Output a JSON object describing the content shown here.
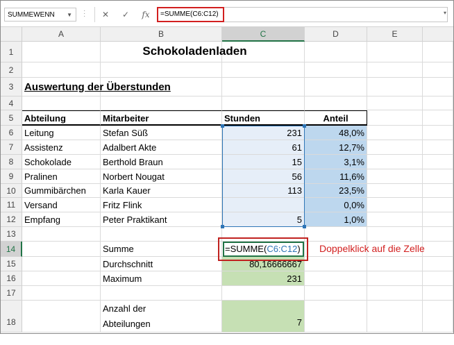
{
  "formula_bar": {
    "name_box": "SUMMEWENN",
    "cancel_icon": "✕",
    "enter_icon": "✓",
    "fx_label": "fx",
    "formula": "=SUMME(C6:C12)"
  },
  "columns": [
    "A",
    "B",
    "C",
    "D",
    "E"
  ],
  "rows": [
    "1",
    "2",
    "3",
    "4",
    "5",
    "6",
    "7",
    "8",
    "9",
    "10",
    "11",
    "12",
    "13",
    "14",
    "15",
    "16",
    "17",
    "18"
  ],
  "sheet": {
    "title": "Schokoladenladen",
    "subtitle": "Auswertung der Überstunden",
    "headers": {
      "a": "Abteilung",
      "b": "Mitarbeiter",
      "c": "Stunden",
      "d": "Anteil"
    },
    "data": [
      {
        "a": "Leitung",
        "b": "Stefan Süß",
        "c": "231",
        "d": "48,0%"
      },
      {
        "a": "Assistenz",
        "b": "Adalbert Akte",
        "c": "61",
        "d": "12,7%"
      },
      {
        "a": "Schokolade",
        "b": "Berthold Braun",
        "c": "15",
        "d": "3,1%"
      },
      {
        "a": "Pralinen",
        "b": "Norbert Nougat",
        "c": "56",
        "d": "11,6%"
      },
      {
        "a": "Gummibärchen",
        "b": "Karla Kauer",
        "c": "113",
        "d": "23,5%"
      },
      {
        "a": "Versand",
        "b": "Fritz Flink",
        "c": "",
        "d": "0,0%"
      },
      {
        "a": "Empfang",
        "b": "Peter Praktikant",
        "c": "5",
        "d": "1,0%"
      }
    ],
    "summary": {
      "sum_label": "Summe",
      "sum_edit_prefix": "=SUMME(",
      "sum_edit_ref": "C6:C12",
      "sum_edit_suffix": ")",
      "avg_label": "Durchschnitt",
      "avg_value": "80,16666667",
      "max_label": "Maximum",
      "max_value": "231",
      "count_label_1": "Anzahl der",
      "count_label_2": "Abteilungen",
      "count_value": "7"
    }
  },
  "annotation": {
    "text": "Doppelklick auf die Zelle"
  },
  "colors": {
    "blue_fill": "#bdd7ee",
    "green_fill": "#c6e0b4",
    "red_highlight": "#d21f1f",
    "excel_green": "#217346"
  }
}
